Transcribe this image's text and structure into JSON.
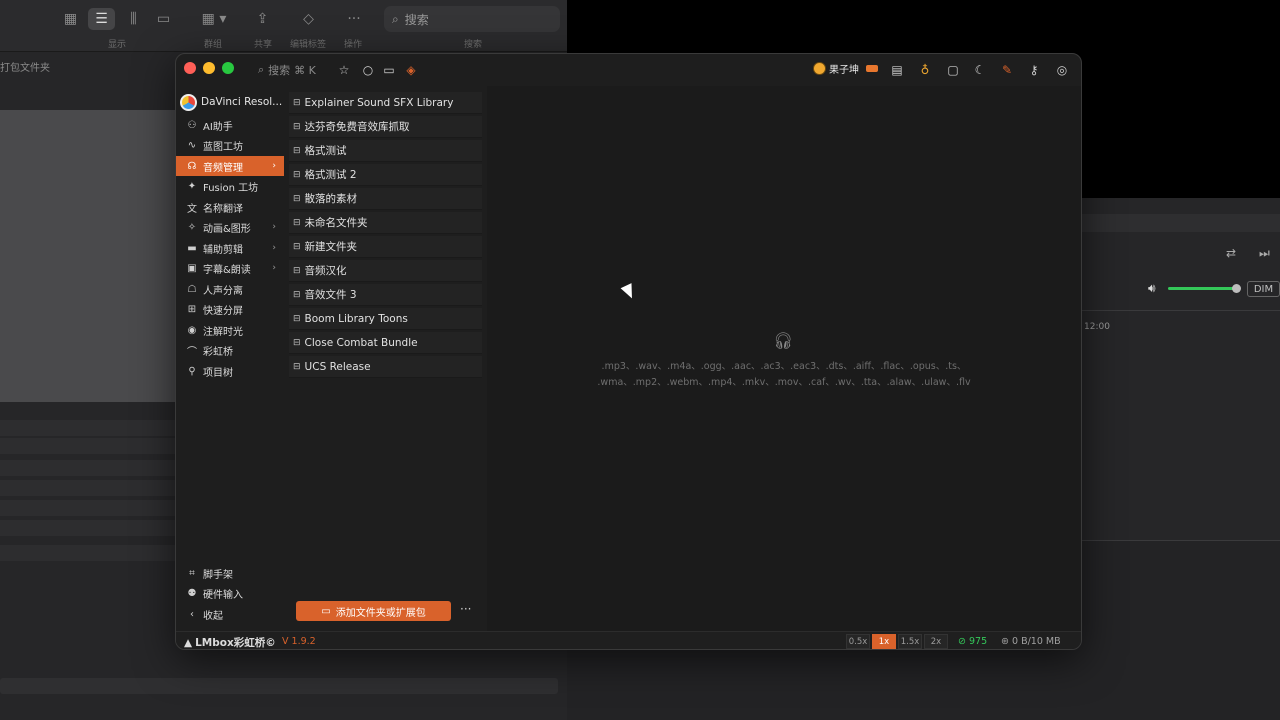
{
  "background": {
    "toolbar": {
      "labels": [
        "显示",
        "群组",
        "共享",
        "编辑标签",
        "操作",
        "搜索"
      ],
      "search_placeholder": "搜索"
    },
    "path_text": "打包文件夹",
    "dim_label": "DIM",
    "timecode": "12:00"
  },
  "app": {
    "search": {
      "label": "搜索",
      "shortcut": "⌘ K"
    },
    "user": {
      "name": "果子坤"
    },
    "sidebar": {
      "header": "DaVinci Resol...",
      "items": [
        {
          "label": "AI助手",
          "icon": "ai-icon"
        },
        {
          "label": "蓝图工坊",
          "icon": "blueprint-icon"
        },
        {
          "label": "音频管理",
          "icon": "audio-icon",
          "active": true,
          "chevron": true
        },
        {
          "label": "Fusion 工坊",
          "icon": "fusion-icon"
        },
        {
          "label": "名称翻译",
          "icon": "translate-icon"
        },
        {
          "label": "动画&图形",
          "icon": "animation-icon",
          "chevron": true
        },
        {
          "label": "辅助剪辑",
          "icon": "edit-icon",
          "chevron": true
        },
        {
          "label": "字幕&朗读",
          "icon": "subtitle-icon",
          "chevron": true
        },
        {
          "label": "人声分离",
          "icon": "vocal-icon"
        },
        {
          "label": "快速分屏",
          "icon": "split-icon"
        },
        {
          "label": "注解时光",
          "icon": "annotation-icon"
        },
        {
          "label": "彩虹桥",
          "icon": "rainbow-icon"
        },
        {
          "label": "项目树",
          "icon": "tree-icon"
        }
      ],
      "bottom": [
        {
          "label": "脚手架",
          "icon": "scaffold-icon"
        },
        {
          "label": "硬件输入",
          "icon": "hardware-icon"
        },
        {
          "label": "收起",
          "icon": "collapse-icon"
        }
      ]
    },
    "folders": [
      "Explainer Sound SFX Library",
      "达芬奇免费音效库抓取",
      "格式测试",
      "格式测试 2",
      "散落的素材",
      "未命名文件夹",
      "新建文件夹",
      "音频汉化",
      "音效文件 3",
      "Boom Library Toons",
      "Close Combat Bundle",
      "UCS Release"
    ],
    "add_folder_label": "添加文件夹或扩展包",
    "more_label": "···",
    "formats_line1": ".mp3、.wav、.m4a、.ogg、.aac、.ac3、.eac3、.dts、.aiff、.flac、.opus、.ts、",
    "formats_line2": ".wma、.mp2、.webm、.mp4、.mkv、.mov、.caf、.wv、.tta、.alaw、.ulaw、.flv",
    "status": {
      "brand": "LMbox彩虹桥©",
      "version": "V 1.9.2",
      "speeds": [
        "0.5x",
        "1x",
        "1.5x",
        "2x"
      ],
      "active_speed": "1x",
      "count": "975",
      "storage": "0 B/10 MB"
    }
  },
  "colors": {
    "accent": "#d9622b",
    "success": "#34c759"
  }
}
